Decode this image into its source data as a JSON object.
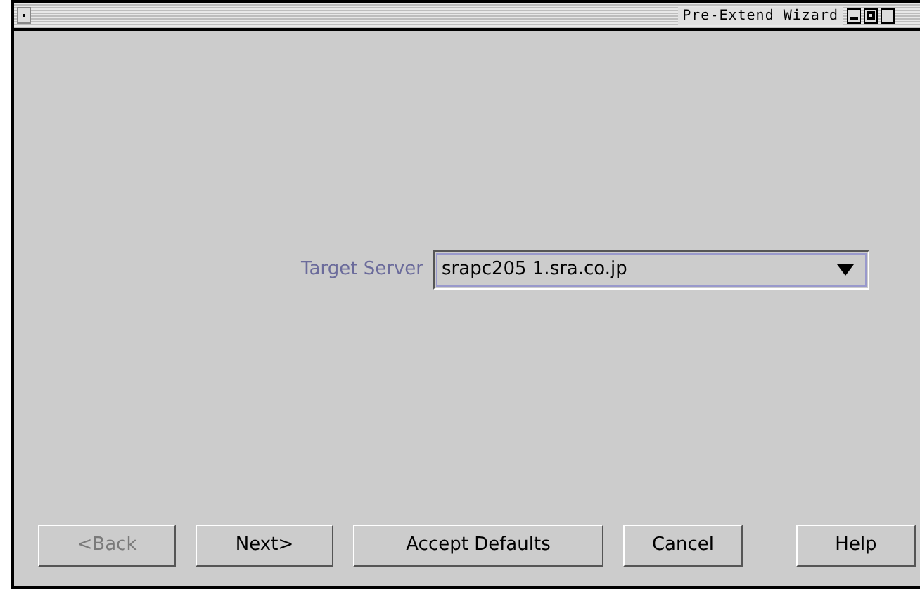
{
  "window": {
    "title": "Pre-Extend Wizard"
  },
  "target_server": {
    "label": "Target Server",
    "value": "srapc205 1.sra.co.jp"
  },
  "buttons": [
    {
      "label": "<Back",
      "disabled": true
    },
    {
      "label": "Next>",
      "disabled": false
    },
    {
      "label": "Accept Defaults",
      "disabled": false
    },
    {
      "label": "Cancel",
      "disabled": false
    },
    {
      "label": "Help",
      "disabled": false
    }
  ]
}
